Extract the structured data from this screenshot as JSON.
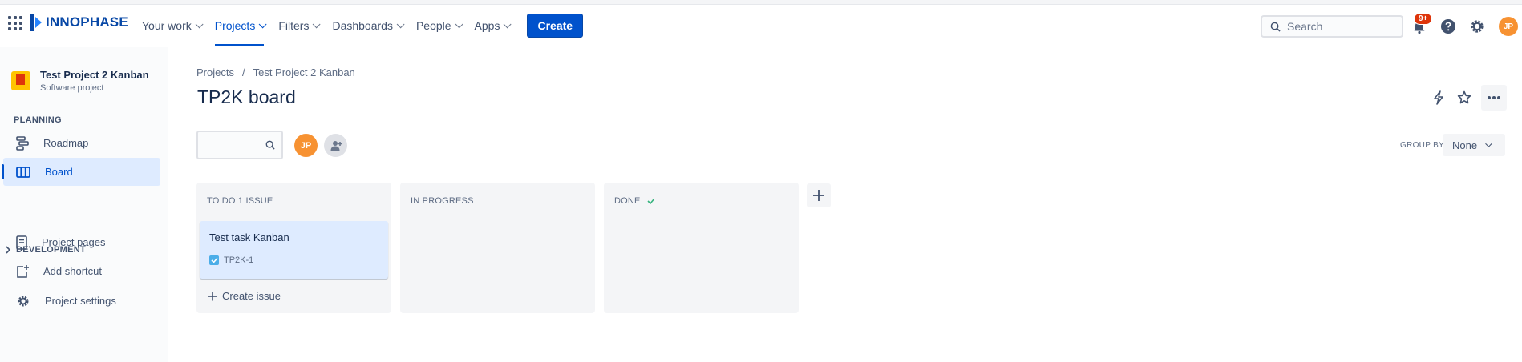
{
  "brand": {
    "name": "INNOPHASE"
  },
  "topnav": {
    "items": [
      {
        "label": "Your work"
      },
      {
        "label": "Projects"
      },
      {
        "label": "Filters"
      },
      {
        "label": "Dashboards"
      },
      {
        "label": "People"
      },
      {
        "label": "Apps"
      }
    ],
    "create_label": "Create",
    "search_placeholder": "Search",
    "notifications_badge": "9+",
    "user_initials": "JP"
  },
  "sidebar": {
    "project_name": "Test Project 2 Kanban",
    "project_type": "Software project",
    "planning_label": "PLANNING",
    "planning_items": [
      {
        "label": "Roadmap",
        "icon": "roadmap-icon"
      },
      {
        "label": "Board",
        "icon": "board-icon"
      }
    ],
    "development_label": "DEVELOPMENT",
    "bottom_items": [
      {
        "label": "Project pages",
        "icon": "pages-icon"
      },
      {
        "label": "Add shortcut",
        "icon": "add-shortcut-icon"
      },
      {
        "label": "Project settings",
        "icon": "gear-icon"
      }
    ]
  },
  "main": {
    "breadcrumb": {
      "first": "Projects",
      "separator": "/",
      "second": "Test Project 2 Kanban"
    },
    "title": "TP2K board",
    "avatar_initials": "JP",
    "group_by_label": "GROUP BY",
    "group_by_value": "None",
    "columns": [
      {
        "title": "TO DO 1 ISSUE"
      },
      {
        "title": "IN PROGRESS"
      },
      {
        "title": "DONE"
      }
    ],
    "card": {
      "title": "Test task Kanban",
      "key": "TP2K-1"
    },
    "create_issue_label": "Create issue"
  },
  "colors": {
    "accent": "#0052cc",
    "column_bg": "#f4f5f7",
    "card_bg": "#deebff",
    "avatar": "#f79232",
    "badge": "#de350b",
    "done_check": "#36b37e"
  }
}
